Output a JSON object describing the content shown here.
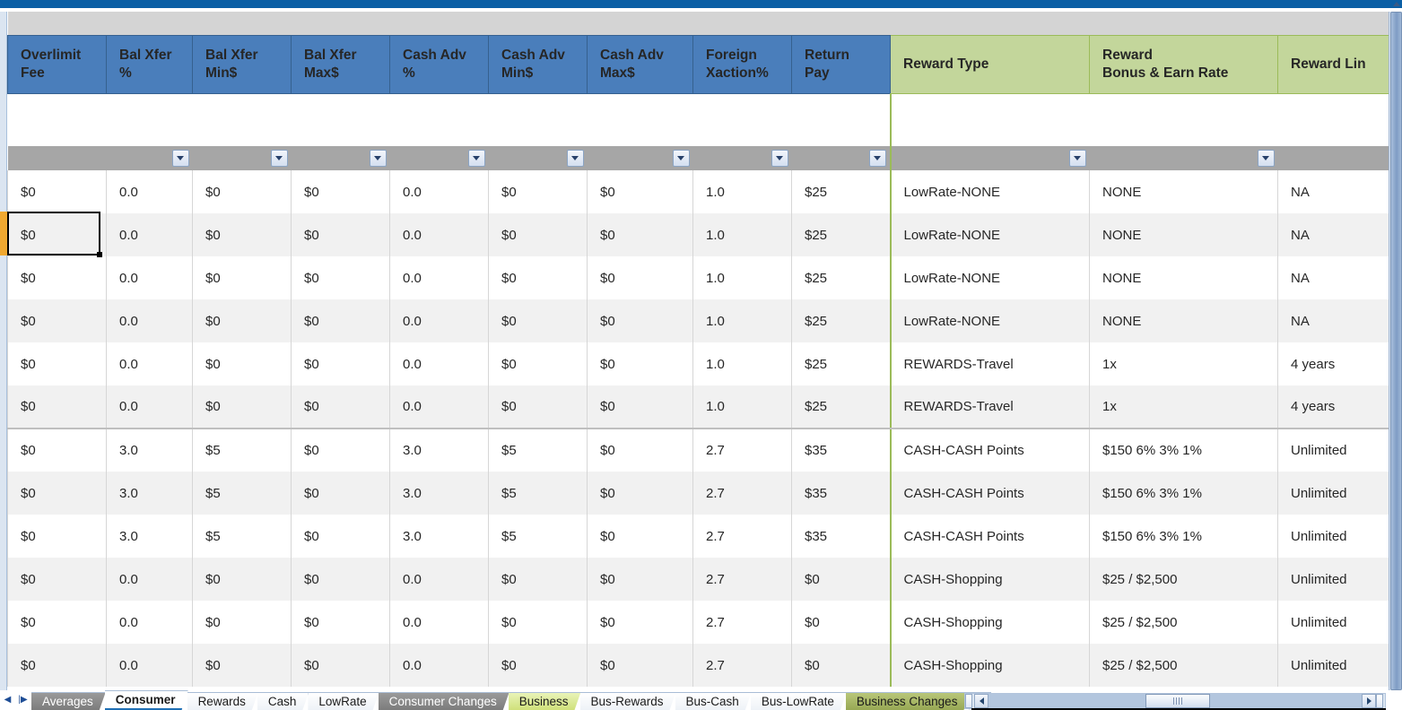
{
  "app": {
    "name": "spreadsheet"
  },
  "columns": [
    {
      "key": "overlimit_fee",
      "l1": "Overlimit",
      "l2": "Fee",
      "group": "fee",
      "filter": false
    },
    {
      "key": "bal_xfer_pct",
      "l1": "Bal Xfer",
      "l2": "%",
      "group": "fee",
      "filter": true
    },
    {
      "key": "bal_xfer_min",
      "l1": "Bal Xfer",
      "l2": "Min$",
      "group": "fee",
      "filter": true
    },
    {
      "key": "bal_xfer_max",
      "l1": "Bal Xfer",
      "l2": "Max$",
      "group": "fee",
      "filter": true
    },
    {
      "key": "cash_adv_pct",
      "l1": "Cash Adv",
      "l2": "%",
      "group": "fee",
      "filter": true
    },
    {
      "key": "cash_adv_min",
      "l1": "Cash Adv",
      "l2": "Min$",
      "group": "fee",
      "filter": true
    },
    {
      "key": "cash_adv_max",
      "l1": "Cash Adv",
      "l2": "Max$",
      "group": "fee",
      "filter": true
    },
    {
      "key": "foreign_xaction",
      "l1": "Foreign",
      "l2": "Xaction%",
      "group": "fee",
      "filter": true
    },
    {
      "key": "return_pay",
      "l1": "Return",
      "l2": "Pay",
      "group": "fee",
      "filter": true
    },
    {
      "key": "reward_type",
      "l1": "Reward Type",
      "l2": "",
      "group": "reward",
      "filter": true
    },
    {
      "key": "reward_bonus",
      "l1": "Reward",
      "l2": "Bonus & Earn Rate",
      "group": "reward",
      "filter": true
    },
    {
      "key": "reward_limit",
      "l1": "Reward Lin",
      "l2": "",
      "group": "reward",
      "filter": false
    }
  ],
  "rows": [
    {
      "cells": [
        "$0",
        "0.0",
        "$0",
        "$0",
        "0.0",
        "$0",
        "$0",
        "1.0",
        "$25",
        "LowRate-NONE",
        "NONE",
        "NA"
      ],
      "styles": [
        "",
        "",
        "",
        "",
        "",
        "",
        "",
        "",
        "",
        "link",
        "",
        ""
      ],
      "alt": false,
      "group_end": false
    },
    {
      "cells": [
        "$0",
        "0.0",
        "$0",
        "$0",
        "0.0",
        "$0",
        "$0",
        "1.0",
        "$25",
        "LowRate-NONE",
        "NONE",
        "NA"
      ],
      "styles": [
        "",
        "",
        "",
        "",
        "",
        "",
        "",
        "",
        "",
        "link",
        "",
        ""
      ],
      "alt": true,
      "group_end": false
    },
    {
      "cells": [
        "$0",
        "0.0",
        "$0",
        "$0",
        "0.0",
        "$0",
        "$0",
        "1.0",
        "$25",
        "LowRate-NONE",
        "NONE",
        "NA"
      ],
      "styles": [
        "",
        "",
        "",
        "",
        "",
        "",
        "",
        "",
        "",
        "link",
        "",
        ""
      ],
      "alt": false,
      "group_end": false
    },
    {
      "cells": [
        "$0",
        "0.0",
        "$0",
        "$0",
        "0.0",
        "$0",
        "$0",
        "1.0",
        "$25",
        "LowRate-NONE",
        "NONE",
        "NA"
      ],
      "styles": [
        "",
        "",
        "",
        "",
        "",
        "",
        "",
        "",
        "",
        "link",
        "",
        ""
      ],
      "alt": true,
      "group_end": false
    },
    {
      "cells": [
        "$0",
        "0.0",
        "$0",
        "$0",
        "0.0",
        "$0",
        "$0",
        "1.0",
        "$25",
        "REWARDS-Travel",
        "1x",
        "4 years"
      ],
      "styles": [
        "",
        "",
        "",
        "",
        "",
        "",
        "",
        "",
        "",
        "link",
        "",
        ""
      ],
      "alt": false,
      "group_end": false
    },
    {
      "cells": [
        "$0",
        "0.0",
        "$0",
        "$0",
        "0.0",
        "$0",
        "$0",
        "1.0",
        "$25",
        "REWARDS-Travel",
        "1x",
        "4 years"
      ],
      "styles": [
        "",
        "",
        "",
        "",
        "",
        "",
        "",
        "",
        "",
        "link",
        "",
        ""
      ],
      "alt": true,
      "group_end": true
    },
    {
      "cells": [
        "$0",
        "3.0",
        "$5",
        "$0",
        "3.0",
        "$5",
        "$0",
        "2.7",
        "$35",
        "CASH-CASH Points",
        "$150  6% 3% 1%",
        "Unlimited"
      ],
      "styles": [
        "",
        "",
        "",
        "",
        "",
        "",
        "",
        "",
        "",
        "link",
        "",
        ""
      ],
      "alt": false,
      "group_end": false
    },
    {
      "cells": [
        "$0",
        "3.0",
        "$5",
        "$0",
        "3.0",
        "$5",
        "$0",
        "2.7",
        "$35",
        "CASH-CASH Points",
        "$150  6% 3% 1%",
        "Unlimited"
      ],
      "styles": [
        "",
        "",
        "",
        "",
        "",
        "",
        "",
        "",
        "",
        "link",
        "",
        ""
      ],
      "alt": true,
      "group_end": false
    },
    {
      "cells": [
        "$0",
        "3.0",
        "$5",
        "$0",
        "3.0",
        "$5",
        "$0",
        "2.7",
        "$35",
        "CASH-CASH Points",
        "$150  6% 3% 1%",
        "Unlimited"
      ],
      "styles": [
        "",
        "",
        "",
        "",
        "",
        "",
        "",
        "",
        "",
        "link",
        "",
        ""
      ],
      "alt": false,
      "group_end": false
    },
    {
      "cells": [
        "$0",
        "0.0",
        "$0",
        "$0",
        "0.0",
        "$0",
        "$0",
        "2.7",
        "$0",
        "CASH-Shopping",
        "$25 / $2,500",
        "Unlimited"
      ],
      "styles": [
        "",
        "red",
        "red",
        "",
        "red",
        "red",
        "",
        "",
        "red",
        "link",
        "purple",
        ""
      ],
      "alt": true,
      "group_end": false
    },
    {
      "cells": [
        "$0",
        "0.0",
        "$0",
        "$0",
        "0.0",
        "$0",
        "$0",
        "2.7",
        "$0",
        "CASH-Shopping",
        "$25 / $2,500",
        "Unlimited"
      ],
      "styles": [
        "",
        "red",
        "red",
        "",
        "red",
        "red",
        "",
        "",
        "red",
        "link",
        "purple",
        ""
      ],
      "alt": false,
      "group_end": false
    },
    {
      "cells": [
        "$0",
        "0.0",
        "$0",
        "$0",
        "0.0",
        "$0",
        "$0",
        "2.7",
        "$0",
        "CASH-Shopping",
        "$25 / $2,500",
        "Unlimited"
      ],
      "styles": [
        "",
        "red",
        "red",
        "",
        "red",
        "red",
        "",
        "",
        "red",
        "link",
        "purple",
        ""
      ],
      "alt": true,
      "group_end": false
    }
  ],
  "selection": {
    "value": "$0",
    "row": 2,
    "column": "overlimit_fee"
  },
  "sheet_tabs": [
    {
      "label": "Averages",
      "state": "gray",
      "active": false
    },
    {
      "label": "Consumer",
      "state": "active",
      "active": true
    },
    {
      "label": "Rewards",
      "state": "plain",
      "active": false
    },
    {
      "label": "Cash",
      "state": "plain",
      "active": false
    },
    {
      "label": "LowRate",
      "state": "plain",
      "active": false
    },
    {
      "label": "Consumer Changes",
      "state": "gray",
      "active": false
    },
    {
      "label": "Business",
      "state": "lime",
      "active": false
    },
    {
      "label": "Bus-Rewards",
      "state": "plain",
      "active": false
    },
    {
      "label": "Bus-Cash",
      "state": "plain",
      "active": false
    },
    {
      "label": "Bus-LowRate",
      "state": "plain",
      "active": false
    },
    {
      "label": "Business Changes",
      "state": "olive",
      "active": false
    }
  ],
  "tab_nav": {
    "first": "◀",
    "prev": "◀|",
    "next": "|▶",
    "last": "▶"
  },
  "colors": {
    "fee_header_bg": "#4a7ebb",
    "reward_header_bg": "#c3d69b",
    "filter_row_bg": "#a6a6a6",
    "link_text": "#1f6fb5",
    "red_text": "#e8121a",
    "purple_text": "#7030a0",
    "alt_row_bg": "#f1f1f1",
    "group_divider": "#9bbb59",
    "top_strip": "#0b5fa5"
  }
}
